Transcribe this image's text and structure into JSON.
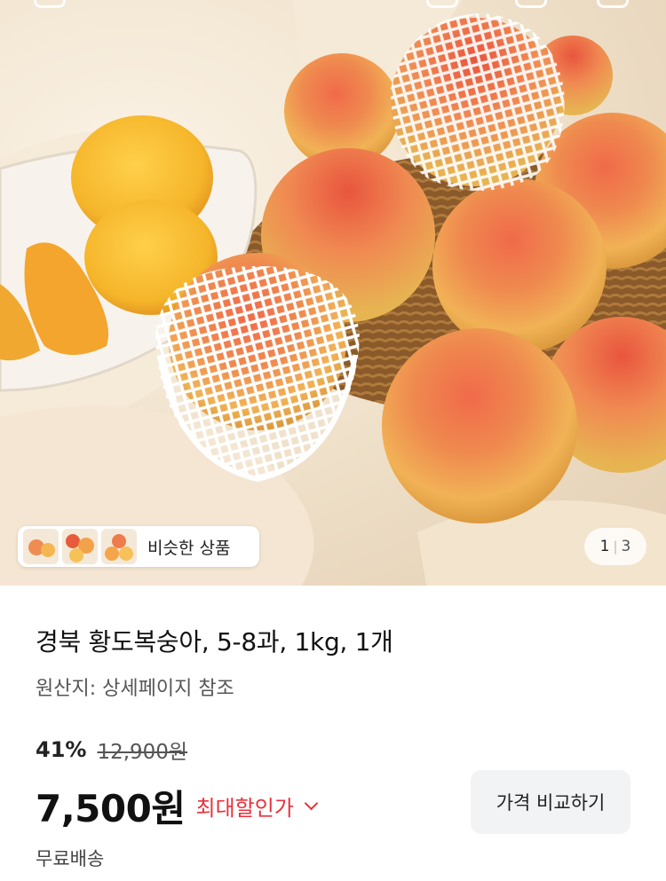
{
  "hero": {
    "alt_subject": "peaches",
    "similar_chip": {
      "label": "비슷한 상품"
    },
    "page_indicator": {
      "current": "1",
      "total": "3"
    }
  },
  "product": {
    "title": "경북 황도복숭아, 5-8과, 1kg, 1개",
    "origin": "원산지: 상세페이지 참조",
    "discount_rate": "41%",
    "original_price": "12,900원",
    "price": "7,500원",
    "max_discount_label": "최대할인가",
    "compare_button": "가격 비교하기",
    "shipping": "무료배송"
  },
  "colors": {
    "accent_red": "#e8323c",
    "button_bg": "#f2f3f5"
  },
  "icons": [
    "back-icon",
    "home-icon",
    "search-icon",
    "cart-icon",
    "chevron-down-icon"
  ]
}
